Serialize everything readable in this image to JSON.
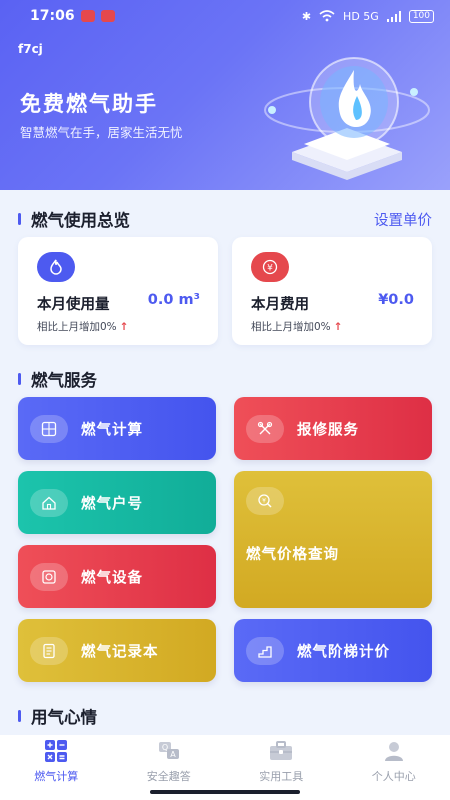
{
  "status_bar": {
    "time": "17:06",
    "network": "HD 5G",
    "battery": "100"
  },
  "header": {
    "app_id": "f7cj",
    "title": "免费燃气助手",
    "subtitle": "智慧燃气在手，居家生活无忧"
  },
  "overview": {
    "title": "燃气使用总览",
    "link": "设置单价",
    "cards": [
      {
        "label": "本月使用量",
        "value": "0.0 m³",
        "compare": "相比上月增加0%",
        "icon": "flame-icon",
        "color": "#4d5af0"
      },
      {
        "label": "本月费用",
        "value": "¥0.0",
        "compare": "相比上月增加0%",
        "icon": "yen-icon",
        "color": "#e5484d"
      }
    ],
    "arrow": "↑"
  },
  "services": {
    "title": "燃气服务",
    "items": [
      {
        "label": "燃气计算",
        "icon": "calculator-icon",
        "color": "#4d5af0"
      },
      {
        "label": "报修服务",
        "icon": "tools-icon",
        "color": "#e23d4b"
      },
      {
        "label": "燃气户号",
        "icon": "home-icon",
        "color": "#14b8a0"
      },
      {
        "label": "燃气价格查询",
        "icon": "price-search-icon",
        "color": "#d8b42a"
      },
      {
        "label": "燃气设备",
        "icon": "device-icon",
        "color": "#e23d4b"
      },
      {
        "label": "燃气记录本",
        "icon": "notebook-icon",
        "color": "#d8b42a"
      },
      {
        "label": "燃气阶梯计价",
        "icon": "stairs-icon",
        "color": "#4d5af0"
      }
    ]
  },
  "mood": {
    "title": "用气心情"
  },
  "tabbar": {
    "items": [
      {
        "label": "燃气计算",
        "icon": "calculator-grid-icon",
        "active": true
      },
      {
        "label": "安全趣答",
        "icon": "quiz-icon",
        "active": false
      },
      {
        "label": "实用工具",
        "icon": "toolbox-icon",
        "active": false
      },
      {
        "label": "个人中心",
        "icon": "user-icon",
        "active": false
      }
    ]
  },
  "colors": {
    "accent": "#4d5af0",
    "red": "#e5484d",
    "teal": "#14b8a0",
    "gold": "#d8b42a"
  }
}
